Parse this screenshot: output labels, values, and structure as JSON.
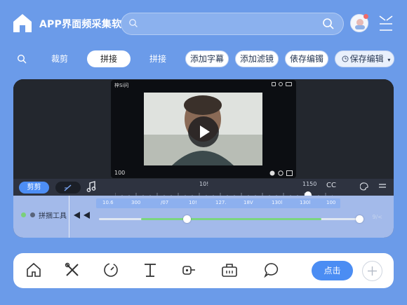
{
  "header": {
    "app_title": "APP界面频采集软",
    "search_placeholder": "",
    "avatar_label": "用户头像"
  },
  "toolbar": {
    "tabs": [
      {
        "label": "裁剪",
        "active": false
      },
      {
        "label": "拼接",
        "active": true
      },
      {
        "label": "拼接",
        "active": false
      }
    ],
    "pills": [
      "添加字幕",
      "添加滤镜",
      "俵存编镯"
    ],
    "save_label": "保存编辑"
  },
  "preview": {
    "window_title": "梓Si问",
    "frame_count": "100"
  },
  "timeline": {
    "cut_tab": "剪剪",
    "marker_left": "10!",
    "marker_right": "1150",
    "cc_label": "CC",
    "strip_numbers": [
      "10.6",
      "300",
      "/07",
      "10!",
      "127.",
      "18V",
      "130l",
      "130l",
      "100"
    ],
    "track_label": "拼捆工具",
    "track_end": "9/<",
    "progress": 0.69
  },
  "dock": {
    "icons": [
      "home-icon",
      "tools-icon",
      "speed-icon",
      "text-icon",
      "key-icon",
      "bag-icon",
      "chat-icon"
    ],
    "cta_label": "点击"
  },
  "colors": {
    "background": "#6b9be9",
    "accent": "#4b8df3",
    "editor_bg": "#21252d",
    "track_bg": "#a3baea",
    "progress_fill": "#7bd680"
  }
}
